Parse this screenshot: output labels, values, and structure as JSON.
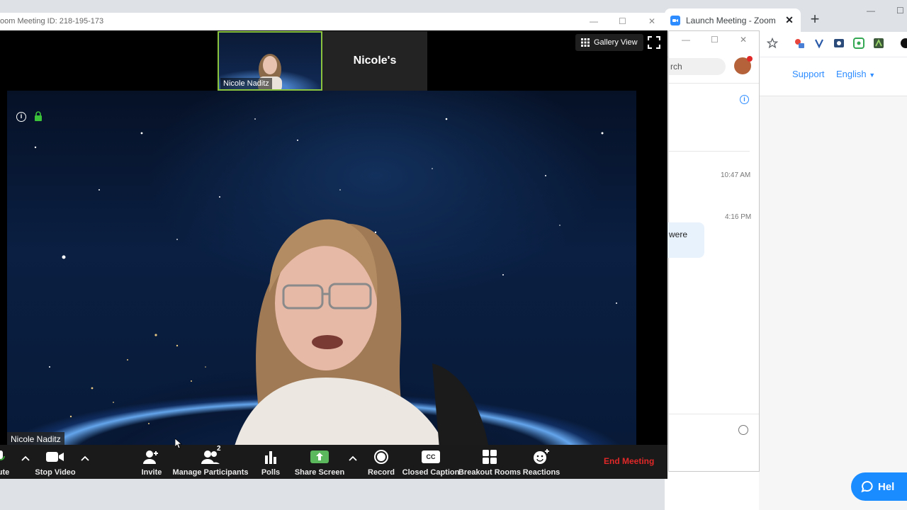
{
  "meeting": {
    "title": "oom Meeting ID: 218-195-173",
    "gallery_view_label": "Gallery View",
    "thumbnail_name": "Nicole Naditz",
    "thumbnail_label": "Nicole's",
    "speaker_name": "Nicole Naditz"
  },
  "toolbar": {
    "mute_label": "ute",
    "stop_video_label": "Stop Video",
    "invite_label": "Invite",
    "participants_label": "Manage Participants",
    "participants_count": "2",
    "polls_label": "Polls",
    "share_screen_label": "Share Screen",
    "record_label": "Record",
    "closed_caption_label": "Closed Caption",
    "cc_icon_text": "CC",
    "breakout_label": "Breakout Rooms",
    "reactions_label": "Reactions",
    "end_meeting_label": "End Meeting"
  },
  "browser": {
    "tab_title": "Launch Meeting - Zoom",
    "support_link": "Support",
    "language_link": "English"
  },
  "chat": {
    "search_placeholder": "rch",
    "time_1": "10:47 AM",
    "time_2": "4:16 PM",
    "bubble_text": "were"
  },
  "help": {
    "label": "Hel"
  },
  "colors": {
    "zoom_blue": "#2d8cff",
    "share_green": "#5cb85c",
    "end_red": "#e02828",
    "active_speaker_border": "#8ac43f"
  }
}
